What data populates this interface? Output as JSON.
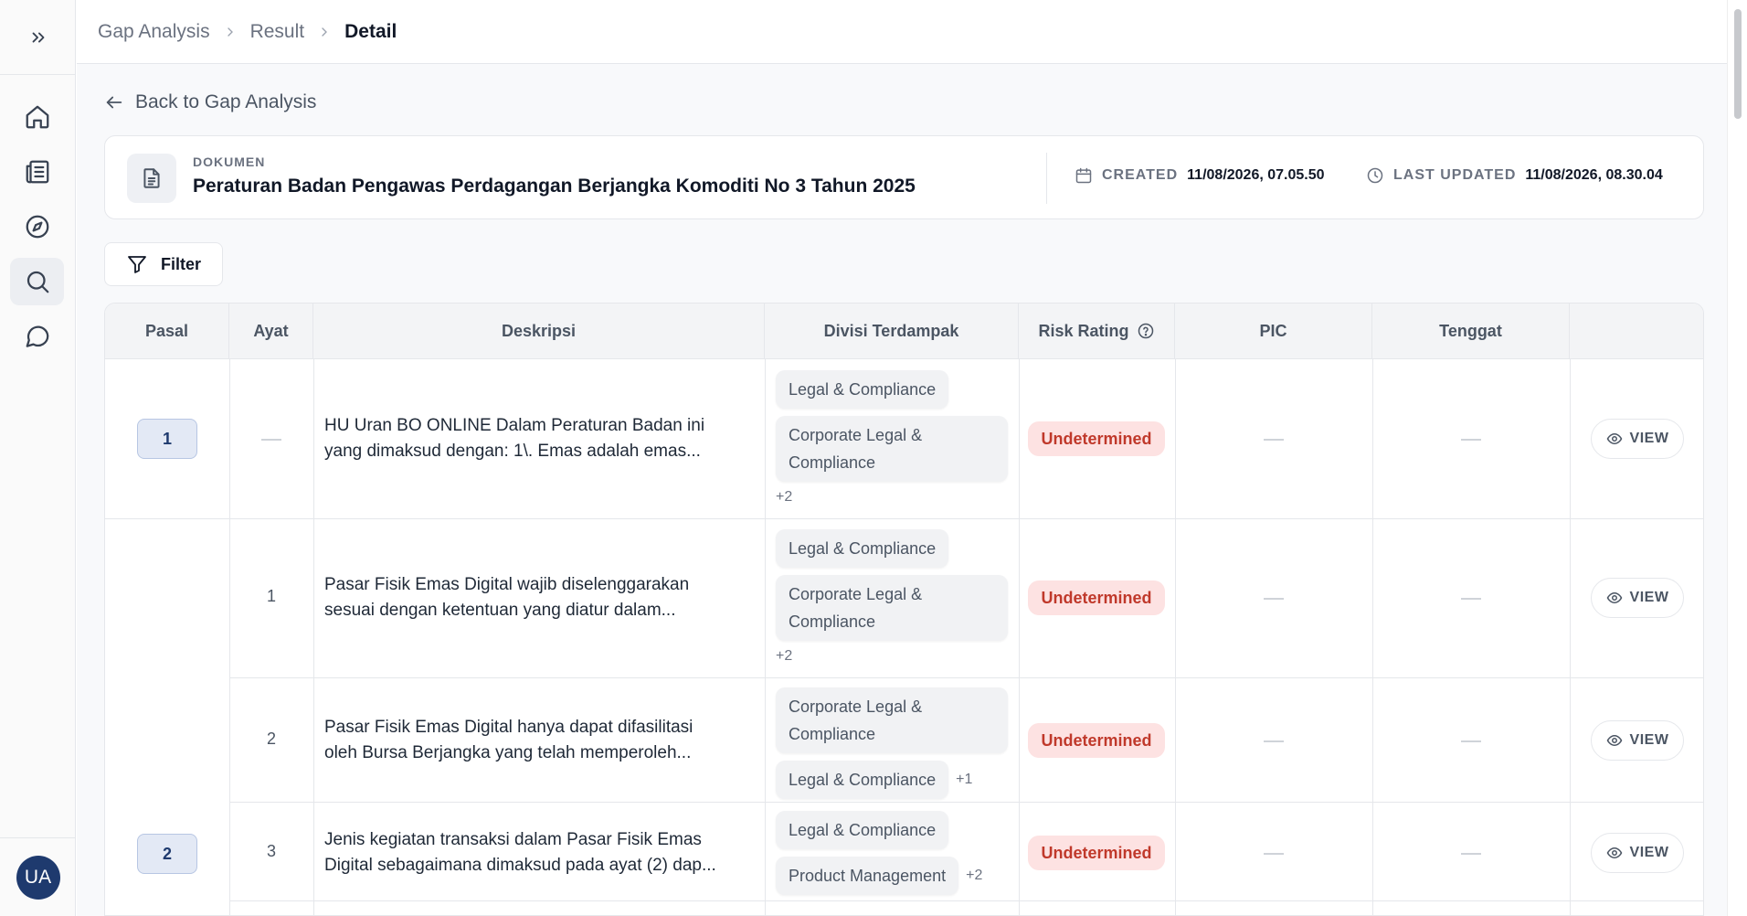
{
  "sidebar": {
    "expand_icon": "chevrons-right-icon",
    "items": [
      {
        "name": "home",
        "icon": "home-icon"
      },
      {
        "name": "documents",
        "icon": "newspaper-icon"
      },
      {
        "name": "explore",
        "icon": "compass-icon"
      },
      {
        "name": "search",
        "icon": "search-icon",
        "active": true
      },
      {
        "name": "chat",
        "icon": "message-circle-icon"
      }
    ],
    "avatar_initials": "UA"
  },
  "breadcrumb": [
    "Gap Analysis",
    "Result",
    "Detail"
  ],
  "back_link": "Back to Gap Analysis",
  "document": {
    "label": "DOKUMEN",
    "title": "Peraturan Badan Pengawas Perdagangan Berjangka Komoditi No 3 Tahun 2025",
    "created_label": "CREATED",
    "created_value": "11/08/2026, 07.05.50",
    "updated_label": "LAST UPDATED",
    "updated_value": "11/08/2026, 08.30.04"
  },
  "filter_label": "Filter",
  "table": {
    "headers": [
      "Pasal",
      "Ayat",
      "Deskripsi",
      "Divisi Terdampak",
      "Risk Rating",
      "PIC",
      "Tenggat",
      ""
    ],
    "rows": [
      {
        "pasal": "1",
        "ayat": "",
        "desc_1": "HU Uran BO ONLINE Dalam Peraturan Badan ini",
        "desc_2": "yang dimaksud dengan: 1\\. Emas adalah emas...",
        "chip_1": "Legal & Compliance",
        "chip_2": "Corporate Legal & Compliance",
        "more": "+2",
        "risk": "Undetermined",
        "view": "VIEW"
      },
      {
        "pasal": "",
        "ayat": "1",
        "desc_1": "Pasar Fisik Emas Digital wajib diselenggarakan",
        "desc_2": "sesuai dengan ketentuan yang diatur dalam...",
        "chip_1": "Legal & Compliance",
        "chip_2": "Corporate Legal & Compliance",
        "more": "+2",
        "risk": "Undetermined",
        "view": "VIEW"
      },
      {
        "pasal": "",
        "ayat": "2",
        "desc_1": "Pasar Fisik Emas Digital hanya dapat difasilitasi",
        "desc_2": "oleh Bursa Berjangka yang telah memperoleh...",
        "chip_1": "Corporate Legal & Compliance",
        "chip_2": "Legal & Compliance",
        "more": "+1",
        "risk": "Undetermined",
        "view": "VIEW"
      },
      {
        "pasal": "2",
        "ayat": "3",
        "desc_1": "Jenis kegiatan transaksi dalam Pasar Fisik Emas",
        "desc_2": "Digital sebagaimana dimaksud pada ayat (2) dap...",
        "chip_1": "Legal & Compliance",
        "chip_2": "Product Management",
        "more": "+2",
        "risk": "Undetermined",
        "view": "VIEW"
      }
    ]
  }
}
